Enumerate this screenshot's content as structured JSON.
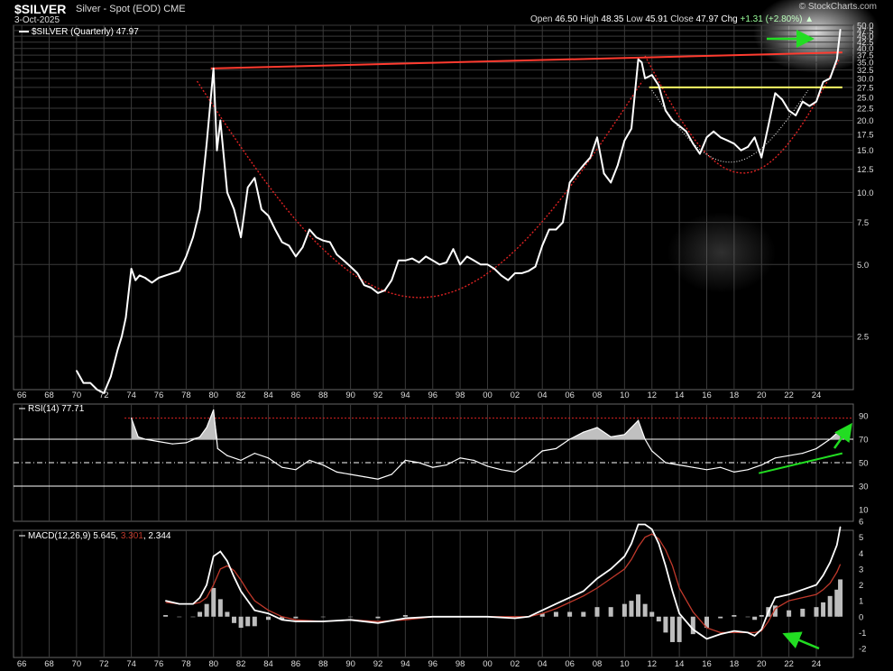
{
  "header": {
    "symbol": "$SILVER",
    "subtitle": "Silver - Spot (EOD)",
    "exchange": "CME",
    "date": "3-Oct-2025",
    "open_label": "Open",
    "open": "46.50",
    "high_label": "High",
    "high": "48.35",
    "low_label": "Low",
    "low": "45.91",
    "close_label": "Close",
    "close": "47.97",
    "chg_label": "Chg",
    "chg": "+1.31 (+2.80%)",
    "chg_arrow": "▲",
    "credit": "© StockCharts.com"
  },
  "colors": {
    "price": "#ffffff",
    "gridline": "#3a3a3a",
    "resistance": "#ff3b2f",
    "neckline": "#ffff66",
    "cup_dotted": "#dd2222",
    "arrow": "#22dd22",
    "rsi_fill": "#c0c0c0",
    "macd_signal": "#c0392b",
    "hist": "#bdbdbd"
  },
  "chart_data": [
    {
      "type": "line",
      "legend": "$SILVER (Quarterly) 47.97",
      "scale": "log",
      "ylim": [
        1.5,
        50
      ],
      "y_ticks": [
        "2.5",
        "5.0",
        "7.5",
        "10.0",
        "12.5",
        "15.0",
        "17.5",
        "20.0",
        "22.5",
        "25.0",
        "27.5",
        "30.0",
        "32.5",
        "35.0",
        "37.5",
        "40.0",
        "42.5",
        "45.0",
        "47.5",
        "50.0"
      ],
      "y_tick_values": [
        2.5,
        5,
        7.5,
        10,
        12.5,
        15,
        17.5,
        20,
        22.5,
        25,
        27.5,
        30,
        32.5,
        35,
        37.5,
        40,
        42.5,
        45,
        47.5,
        50
      ],
      "x_ticks": [
        "66",
        "68",
        "70",
        "72",
        "74",
        "76",
        "78",
        "80",
        "82",
        "84",
        "86",
        "88",
        "90",
        "92",
        "94",
        "96",
        "98",
        "00",
        "02",
        "04",
        "06",
        "08",
        "10",
        "12",
        "14",
        "16",
        "18",
        "20",
        "22",
        "24"
      ],
      "x": [
        1970.0,
        1970.5,
        1971.0,
        1971.5,
        1972.0,
        1972.5,
        1973.0,
        1973.3,
        1973.6,
        1974.0,
        1974.3,
        1974.6,
        1975.0,
        1975.5,
        1976.0,
        1976.5,
        1977.0,
        1977.5,
        1978.0,
        1978.5,
        1979.0,
        1979.5,
        1980.0,
        1980.25,
        1980.5,
        1981.0,
        1981.5,
        1982.0,
        1982.5,
        1983.0,
        1983.5,
        1984.0,
        1984.5,
        1985.0,
        1985.5,
        1986.0,
        1986.5,
        1987.0,
        1987.5,
        1988.0,
        1988.5,
        1989.0,
        1989.5,
        1990.0,
        1990.5,
        1991.0,
        1991.5,
        1992.0,
        1992.5,
        1993.0,
        1993.5,
        1994.0,
        1994.5,
        1995.0,
        1995.5,
        1996.0,
        1996.5,
        1997.0,
        1997.5,
        1998.0,
        1998.5,
        1999.0,
        1999.5,
        2000.0,
        2000.5,
        2001.0,
        2001.5,
        2002.0,
        2002.5,
        2003.0,
        2003.5,
        2004.0,
        2004.5,
        2005.0,
        2005.5,
        2006.0,
        2006.5,
        2007.0,
        2007.5,
        2008.0,
        2008.5,
        2009.0,
        2009.5,
        2010.0,
        2010.5,
        2011.0,
        2011.25,
        2011.5,
        2012.0,
        2012.5,
        2013.0,
        2013.5,
        2014.0,
        2014.5,
        2015.0,
        2015.5,
        2016.0,
        2016.5,
        2017.0,
        2017.5,
        2018.0,
        2018.5,
        2019.0,
        2019.5,
        2020.0,
        2020.5,
        2021.0,
        2021.5,
        2022.0,
        2022.5,
        2023.0,
        2023.5,
        2024.0,
        2024.5,
        2025.0,
        2025.5,
        2025.75
      ],
      "y": [
        1.8,
        1.6,
        1.6,
        1.5,
        1.45,
        1.7,
        2.2,
        2.5,
        3.0,
        4.8,
        4.3,
        4.5,
        4.4,
        4.2,
        4.4,
        4.5,
        4.6,
        4.7,
        5.4,
        6.5,
        8.5,
        16.0,
        33.0,
        15.0,
        20.0,
        10.0,
        8.5,
        6.5,
        10.5,
        11.5,
        8.5,
        8.0,
        7.0,
        6.2,
        6.0,
        5.4,
        5.9,
        7.0,
        6.5,
        6.3,
        6.2,
        5.5,
        5.2,
        4.9,
        4.6,
        4.1,
        4.0,
        3.8,
        3.9,
        4.3,
        5.2,
        5.2,
        5.3,
        5.1,
        5.4,
        5.2,
        5.0,
        5.1,
        5.8,
        5.0,
        5.4,
        5.2,
        5.0,
        5.0,
        4.8,
        4.5,
        4.3,
        4.6,
        4.6,
        4.7,
        4.9,
        6.0,
        7.0,
        7.0,
        7.5,
        11.0,
        12.0,
        13.0,
        14.0,
        17.0,
        12.0,
        11.0,
        13.0,
        16.5,
        18.5,
        36.0,
        35.0,
        30.0,
        31.0,
        28.0,
        22.0,
        20.0,
        19.0,
        18.0,
        16.0,
        14.5,
        17.0,
        18.0,
        17.0,
        16.5,
        16.0,
        15.0,
        15.5,
        17.0,
        14.0,
        19.0,
        26.0,
        24.5,
        22.0,
        21.0,
        24.0,
        23.0,
        24.0,
        29.0,
        30.0,
        36.0,
        47.97
      ],
      "resistance_line": {
        "x": [
          1979.8,
          2025.9
        ],
        "y": [
          33.0,
          38.5
        ]
      },
      "neckline": {
        "x": [
          2011.8,
          2025.9
        ],
        "y": [
          27.5,
          27.5
        ]
      }
    },
    {
      "type": "area",
      "legend": "RSI(14) 77.71",
      "ylim": [
        0,
        100
      ],
      "y_ticks": [
        "10",
        "30",
        "50",
        "70",
        "90"
      ],
      "y_tick_values": [
        10,
        30,
        50,
        70,
        90
      ],
      "reference_lines": [
        70,
        50,
        30,
        88
      ],
      "x": [
        1974.0,
        1974.5,
        1975.0,
        1976.0,
        1977.0,
        1978.0,
        1979.0,
        1979.5,
        1980.0,
        1980.3,
        1981.0,
        1982.0,
        1983.0,
        1984.0,
        1985.0,
        1986.0,
        1987.0,
        1988.0,
        1989.0,
        1990.0,
        1991.0,
        1992.0,
        1993.0,
        1994.0,
        1995.0,
        1996.0,
        1997.0,
        1998.0,
        1999.0,
        2000.0,
        2001.0,
        2002.0,
        2003.0,
        2004.0,
        2005.0,
        2006.0,
        2007.0,
        2008.0,
        2009.0,
        2010.0,
        2011.0,
        2011.5,
        2012.0,
        2013.0,
        2014.0,
        2015.0,
        2016.0,
        2017.0,
        2018.0,
        2019.0,
        2020.0,
        2021.0,
        2022.0,
        2023.0,
        2024.0,
        2025.0,
        2025.75
      ],
      "y": [
        88,
        72,
        70,
        68,
        66,
        67,
        72,
        80,
        95,
        62,
        56,
        52,
        58,
        54,
        46,
        44,
        52,
        48,
        42,
        40,
        38,
        36,
        40,
        52,
        50,
        46,
        48,
        54,
        52,
        47,
        44,
        42,
        50,
        60,
        62,
        70,
        76,
        80,
        72,
        74,
        86,
        70,
        60,
        50,
        48,
        46,
        44,
        46,
        42,
        44,
        48,
        54,
        56,
        58,
        62,
        70,
        77.71
      ],
      "trendline": {
        "x": [
          2019.8,
          2025.9
        ],
        "y": [
          41,
          58
        ]
      }
    },
    {
      "type": "line",
      "legend_name": "MACD(12,26,9)",
      "legend_macd": "5.645",
      "legend_signal": "3.301",
      "legend_hist": "2.344",
      "ylim": [
        -2,
        6
      ],
      "y_ticks": [
        "-2",
        "-1",
        "0",
        "1",
        "2",
        "3",
        "4",
        "5",
        "6"
      ],
      "y_tick_values": [
        -2,
        -1,
        0,
        1,
        2,
        3,
        4,
        5,
        6
      ],
      "x": [
        1976.5,
        1977.5,
        1978.5,
        1979.0,
        1979.5,
        1980.0,
        1980.5,
        1981.0,
        1981.5,
        1982.0,
        1982.5,
        1983.0,
        1984.0,
        1985.0,
        1986.0,
        1988.0,
        1990.0,
        1992.0,
        1994.0,
        1996.0,
        1998.0,
        2000.0,
        2002.0,
        2003.0,
        2004.0,
        2005.0,
        2006.0,
        2007.0,
        2008.0,
        2009.0,
        2010.0,
        2010.5,
        2011.0,
        2011.5,
        2012.0,
        2012.5,
        2013.0,
        2013.5,
        2014.0,
        2015.0,
        2016.0,
        2017.0,
        2018.0,
        2019.0,
        2019.5,
        2020.0,
        2020.5,
        2021.0,
        2022.0,
        2023.0,
        2024.0,
        2024.5,
        2025.0,
        2025.5,
        2025.75
      ],
      "macd": [
        1.0,
        0.8,
        0.8,
        1.2,
        2.0,
        3.8,
        4.1,
        3.5,
        2.5,
        1.6,
        1.0,
        0.4,
        0.2,
        -0.2,
        -0.3,
        -0.3,
        -0.2,
        -0.4,
        -0.1,
        0.0,
        0.0,
        0.0,
        -0.1,
        0.0,
        0.4,
        0.8,
        1.2,
        1.6,
        2.4,
        3.0,
        3.8,
        4.6,
        5.8,
        5.8,
        5.5,
        4.6,
        3.2,
        1.6,
        0.2,
        -0.8,
        -1.4,
        -1.1,
        -0.9,
        -1.0,
        -1.2,
        -0.8,
        0.3,
        1.2,
        1.4,
        1.7,
        2.0,
        2.6,
        3.4,
        4.5,
        5.645
      ],
      "signal": [
        0.9,
        0.8,
        0.8,
        0.9,
        1.2,
        2.0,
        3.0,
        3.2,
        2.9,
        2.3,
        1.6,
        1.0,
        0.4,
        0.0,
        -0.2,
        -0.3,
        -0.2,
        -0.3,
        -0.2,
        0.0,
        0.0,
        0.0,
        0.0,
        0.0,
        0.2,
        0.5,
        0.9,
        1.3,
        1.8,
        2.4,
        3.0,
        3.6,
        4.4,
        5.0,
        5.2,
        4.9,
        4.2,
        3.2,
        1.8,
        0.3,
        -0.7,
        -1.0,
        -1.0,
        -1.0,
        -1.0,
        -0.9,
        -0.3,
        0.5,
        1.0,
        1.2,
        1.4,
        1.7,
        2.1,
        2.8,
        3.301
      ],
      "hist": [
        0.1,
        0.0,
        0.0,
        0.3,
        0.8,
        1.8,
        1.1,
        0.3,
        -0.4,
        -0.7,
        -0.6,
        -0.6,
        -0.2,
        -0.2,
        -0.1,
        0.0,
        0.0,
        -0.1,
        0.1,
        0.0,
        0.0,
        0.0,
        -0.1,
        0.0,
        0.2,
        0.3,
        0.3,
        0.3,
        0.6,
        0.6,
        0.8,
        1.0,
        1.4,
        0.8,
        0.3,
        -0.3,
        -1.0,
        -1.6,
        -1.6,
        -1.1,
        -0.7,
        -0.1,
        0.1,
        0.0,
        -0.2,
        0.1,
        0.6,
        0.7,
        0.4,
        0.5,
        0.6,
        0.9,
        1.3,
        1.7,
        2.344
      ]
    }
  ]
}
